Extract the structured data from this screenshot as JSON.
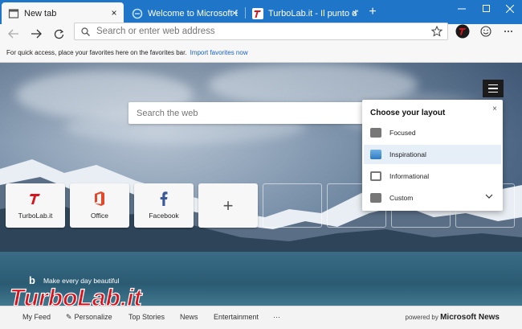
{
  "tabs": [
    {
      "title": "New tab",
      "active": true
    },
    {
      "title": "Welcome to Microsoft Edge Dev",
      "active": false
    },
    {
      "title": "TurboLab.it - Il punto d'incontro",
      "active": false
    }
  ],
  "address": {
    "placeholder": "Search or enter web address"
  },
  "favorites_bar": {
    "text": "For quick access, place your favorites here on the favorites bar.",
    "link": "Import favorites now"
  },
  "search": {
    "placeholder": "Search the web"
  },
  "tiles": [
    {
      "label": "TurboLab.it"
    },
    {
      "label": "Office"
    },
    {
      "label": "Facebook"
    }
  ],
  "add_tile": {
    "symbol": "+"
  },
  "bing": {
    "text": "Make every day beautiful"
  },
  "feed": {
    "items": [
      "My Feed",
      "Personalize",
      "Top Stories",
      "News",
      "Entertainment",
      "···"
    ],
    "powered_prefix": "powered by",
    "powered_brand": "Microsoft News"
  },
  "layout_popup": {
    "title": "Choose your layout",
    "close": "×",
    "options": [
      {
        "label": "Focused",
        "selected": false
      },
      {
        "label": "Inspirational",
        "selected": true
      },
      {
        "label": "Informational",
        "selected": false
      },
      {
        "label": "Custom",
        "selected": false
      }
    ]
  },
  "watermark": {
    "text": "TurboLab.it"
  },
  "colors": {
    "titlebar": "#1f75c8",
    "accent": "#1a61c2",
    "turbolab_red": "#d7141d"
  },
  "icons": [
    "back-icon",
    "forward-icon",
    "refresh-icon",
    "star-icon",
    "profile-icon",
    "emoji-icon",
    "more-icon",
    "hamburger-icon",
    "bing-icon"
  ]
}
